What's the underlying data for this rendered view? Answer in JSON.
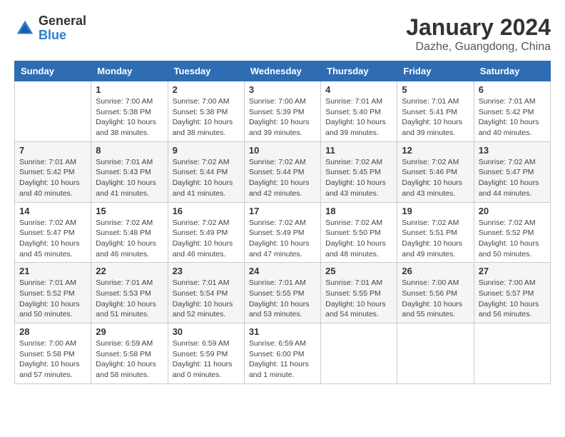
{
  "header": {
    "logo_general": "General",
    "logo_blue": "Blue",
    "main_title": "January 2024",
    "subtitle": "Dazhe, Guangdong, China"
  },
  "weekdays": [
    "Sunday",
    "Monday",
    "Tuesday",
    "Wednesday",
    "Thursday",
    "Friday",
    "Saturday"
  ],
  "weeks": [
    [
      {
        "day": "",
        "info": ""
      },
      {
        "day": "1",
        "info": "Sunrise: 7:00 AM\nSunset: 5:38 PM\nDaylight: 10 hours\nand 38 minutes."
      },
      {
        "day": "2",
        "info": "Sunrise: 7:00 AM\nSunset: 5:38 PM\nDaylight: 10 hours\nand 38 minutes."
      },
      {
        "day": "3",
        "info": "Sunrise: 7:00 AM\nSunset: 5:39 PM\nDaylight: 10 hours\nand 39 minutes."
      },
      {
        "day": "4",
        "info": "Sunrise: 7:01 AM\nSunset: 5:40 PM\nDaylight: 10 hours\nand 39 minutes."
      },
      {
        "day": "5",
        "info": "Sunrise: 7:01 AM\nSunset: 5:41 PM\nDaylight: 10 hours\nand 39 minutes."
      },
      {
        "day": "6",
        "info": "Sunrise: 7:01 AM\nSunset: 5:42 PM\nDaylight: 10 hours\nand 40 minutes."
      }
    ],
    [
      {
        "day": "7",
        "info": "Sunrise: 7:01 AM\nSunset: 5:42 PM\nDaylight: 10 hours\nand 40 minutes."
      },
      {
        "day": "8",
        "info": "Sunrise: 7:01 AM\nSunset: 5:43 PM\nDaylight: 10 hours\nand 41 minutes."
      },
      {
        "day": "9",
        "info": "Sunrise: 7:02 AM\nSunset: 5:44 PM\nDaylight: 10 hours\nand 41 minutes."
      },
      {
        "day": "10",
        "info": "Sunrise: 7:02 AM\nSunset: 5:44 PM\nDaylight: 10 hours\nand 42 minutes."
      },
      {
        "day": "11",
        "info": "Sunrise: 7:02 AM\nSunset: 5:45 PM\nDaylight: 10 hours\nand 43 minutes."
      },
      {
        "day": "12",
        "info": "Sunrise: 7:02 AM\nSunset: 5:46 PM\nDaylight: 10 hours\nand 43 minutes."
      },
      {
        "day": "13",
        "info": "Sunrise: 7:02 AM\nSunset: 5:47 PM\nDaylight: 10 hours\nand 44 minutes."
      }
    ],
    [
      {
        "day": "14",
        "info": "Sunrise: 7:02 AM\nSunset: 5:47 PM\nDaylight: 10 hours\nand 45 minutes."
      },
      {
        "day": "15",
        "info": "Sunrise: 7:02 AM\nSunset: 5:48 PM\nDaylight: 10 hours\nand 46 minutes."
      },
      {
        "day": "16",
        "info": "Sunrise: 7:02 AM\nSunset: 5:49 PM\nDaylight: 10 hours\nand 46 minutes."
      },
      {
        "day": "17",
        "info": "Sunrise: 7:02 AM\nSunset: 5:49 PM\nDaylight: 10 hours\nand 47 minutes."
      },
      {
        "day": "18",
        "info": "Sunrise: 7:02 AM\nSunset: 5:50 PM\nDaylight: 10 hours\nand 48 minutes."
      },
      {
        "day": "19",
        "info": "Sunrise: 7:02 AM\nSunset: 5:51 PM\nDaylight: 10 hours\nand 49 minutes."
      },
      {
        "day": "20",
        "info": "Sunrise: 7:02 AM\nSunset: 5:52 PM\nDaylight: 10 hours\nand 50 minutes."
      }
    ],
    [
      {
        "day": "21",
        "info": "Sunrise: 7:01 AM\nSunset: 5:52 PM\nDaylight: 10 hours\nand 50 minutes."
      },
      {
        "day": "22",
        "info": "Sunrise: 7:01 AM\nSunset: 5:53 PM\nDaylight: 10 hours\nand 51 minutes."
      },
      {
        "day": "23",
        "info": "Sunrise: 7:01 AM\nSunset: 5:54 PM\nDaylight: 10 hours\nand 52 minutes."
      },
      {
        "day": "24",
        "info": "Sunrise: 7:01 AM\nSunset: 5:55 PM\nDaylight: 10 hours\nand 53 minutes."
      },
      {
        "day": "25",
        "info": "Sunrise: 7:01 AM\nSunset: 5:55 PM\nDaylight: 10 hours\nand 54 minutes."
      },
      {
        "day": "26",
        "info": "Sunrise: 7:00 AM\nSunset: 5:56 PM\nDaylight: 10 hours\nand 55 minutes."
      },
      {
        "day": "27",
        "info": "Sunrise: 7:00 AM\nSunset: 5:57 PM\nDaylight: 10 hours\nand 56 minutes."
      }
    ],
    [
      {
        "day": "28",
        "info": "Sunrise: 7:00 AM\nSunset: 5:58 PM\nDaylight: 10 hours\nand 57 minutes."
      },
      {
        "day": "29",
        "info": "Sunrise: 6:59 AM\nSunset: 5:58 PM\nDaylight: 10 hours\nand 58 minutes."
      },
      {
        "day": "30",
        "info": "Sunrise: 6:59 AM\nSunset: 5:59 PM\nDaylight: 11 hours\nand 0 minutes."
      },
      {
        "day": "31",
        "info": "Sunrise: 6:59 AM\nSunset: 6:00 PM\nDaylight: 11 hours\nand 1 minute."
      },
      {
        "day": "",
        "info": ""
      },
      {
        "day": "",
        "info": ""
      },
      {
        "day": "",
        "info": ""
      }
    ]
  ]
}
